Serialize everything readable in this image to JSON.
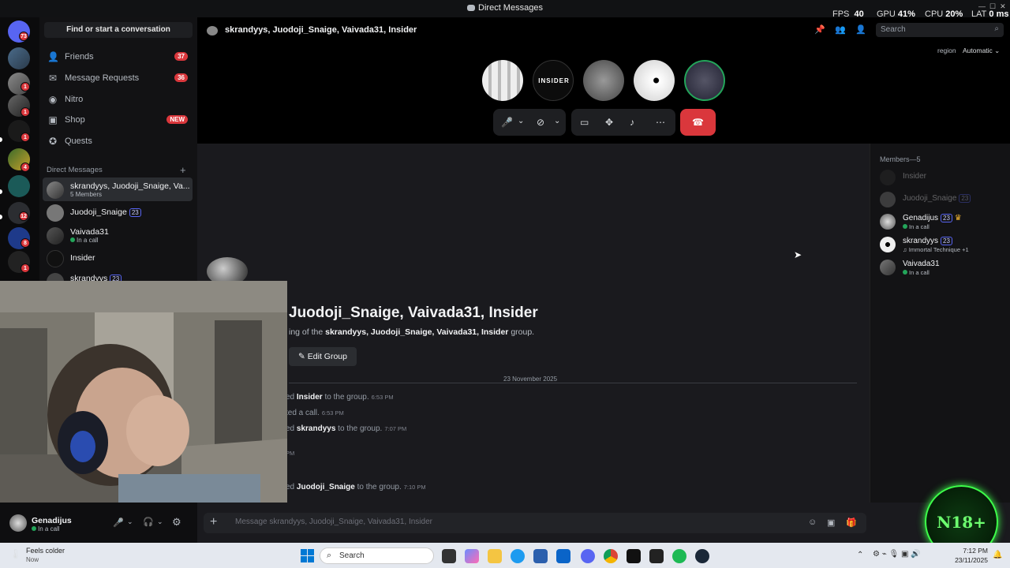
{
  "window": {
    "title": "Direct Messages"
  },
  "overlay": {
    "fps_label": "FPS",
    "fps": "40",
    "gpu_label": "GPU",
    "gpu": "41%",
    "cpu_label": "CPU",
    "cpu": "20%",
    "lat_label": "LAT",
    "lat": "0 ms"
  },
  "sidebar": {
    "find": "Find or start a conversation",
    "nav": [
      {
        "label": "Friends",
        "count": "37"
      },
      {
        "label": "Message Requests",
        "count": "36"
      },
      {
        "label": "Nitro",
        "count": ""
      },
      {
        "label": "Shop",
        "count": "NEW"
      },
      {
        "label": "Quests",
        "count": ""
      }
    ],
    "dm_header": "Direct Messages",
    "dms": [
      {
        "name": "skrandyys, Juodoji_Snaige, Va...",
        "sub": "5 Members",
        "boost": ""
      },
      {
        "name": "Juodoji_Snaige",
        "sub": "",
        "boost": "23"
      },
      {
        "name": "Vaivada31",
        "sub": "In a call",
        "boost": ""
      },
      {
        "name": "Insider",
        "sub": "",
        "boost": ""
      },
      {
        "name": "skrandyys",
        "sub": "",
        "boost": "23"
      }
    ]
  },
  "servers": {
    "badges": [
      "73",
      "1",
      "1",
      "1",
      "4",
      "12",
      "8",
      "1"
    ]
  },
  "user": {
    "name": "Genadijus",
    "status": "In a call"
  },
  "call": {
    "channel": "skrandyys, Juodoji_Snaige, Vaivada31, Insider",
    "search_placeholder": "Search",
    "region_label": "region",
    "region_value": "Automatic",
    "insider_label": "INSIDER"
  },
  "chat": {
    "title": "Juodoji_Snaige, Vaivada31, Insider",
    "intro_prefix": "ing of the",
    "intro_bold": "skrandyys, Juodoji_Snaige, Vaivada31, Insider",
    "intro_suffix": "group.",
    "edit_group": "Edit Group",
    "date": "23 November 2025",
    "messages": [
      {
        "prefix": "ed",
        "bold": "Insider",
        "text": "to the group.",
        "time": "6:53 PM"
      },
      {
        "prefix": "ted a call.",
        "bold": "",
        "text": "",
        "time": "6:53 PM"
      },
      {
        "prefix": "ed",
        "bold": "skrandyys",
        "text": "to the group.",
        "time": "7:07 PM"
      },
      {
        "prefix": "",
        "bold": "",
        "text": "",
        "time": "PM"
      },
      {
        "prefix": "ed",
        "bold": "Juodoji_Snaige",
        "text": "to the group.",
        "time": "7:10 PM"
      }
    ],
    "composer_placeholder": "Message skrandyys, Juodoji_Snaige, Vaivada31, Insider"
  },
  "members": {
    "header": "Members—5",
    "list": [
      {
        "name": "Insider",
        "status": "",
        "boost": ""
      },
      {
        "name": "Juodoji_Snaige",
        "status": "",
        "boost": "23"
      },
      {
        "name": "Genadijus",
        "status": "In a call",
        "boost": "23"
      },
      {
        "name": "skrandyys",
        "status": "Immortal Technique +1",
        "boost": "23"
      },
      {
        "name": "Vaivada31",
        "status": "In a call",
        "boost": ""
      }
    ]
  },
  "badge_overlay": {
    "text": "N18+"
  },
  "taskbar": {
    "weather": "Feels colder",
    "weather_sub": "Now",
    "search": "Search",
    "time": "7:12 PM",
    "date": "23/11/2025"
  },
  "colors": {
    "accent": "#5865f2",
    "danger": "#da373c",
    "online": "#23a55a",
    "hangup": "#da373c"
  }
}
